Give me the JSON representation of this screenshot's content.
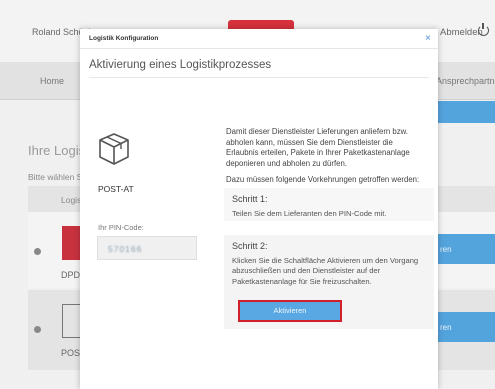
{
  "header": {
    "user_name": "Roland Schönh",
    "logout_label": "Abmelden",
    "icons": {
      "logout": "power-icon",
      "logo": "brand-logo"
    }
  },
  "nav": {
    "home": "Home",
    "contact": "Ansprechpartner"
  },
  "background": {
    "heading": "Ihre Logisti",
    "subtext": "Bitte wählen S",
    "column_header": "Logist",
    "rows": [
      {
        "label": "DPD-",
        "button": "ren"
      },
      {
        "label": "POST-",
        "button": "ren"
      }
    ]
  },
  "modal": {
    "window_title": "Logistik Konfiguration",
    "close_label": "×",
    "heading": "Aktivierung eines Logistikprozesses",
    "provider_name": "POST-AT",
    "pin_label": "Ihr PIN-Code:",
    "pin_value": "570166",
    "intro": "Damit dieser Dienstleister Lieferungen anliefern bzw. abholen kann, müssen Sie dem Dienstleister die Erlaubnis erteilen, Pakete in Ihrer Paketkastenanlage deponieren und abholen zu dürfen.",
    "steps_intro": "Dazu müssen folgende Vorkehrungen getroffen werden:",
    "step1_title": "Schritt 1:",
    "step1_text": "Teilen Sie dem Lieferanten den PIN-Code mit.",
    "step2_title": "Schritt 2:",
    "step2_text": "Klicken Sie die Schaltfläche Aktivieren um den Vorgang abzuschließen und den Dienstleister auf der Paketkastenanlage für Sie freizuschalten.",
    "activate_label": "Aktivieren"
  },
  "colors": {
    "accent_blue": "#53a3dd",
    "highlight_red": "#d2202a",
    "brand_red": "#d6313c"
  }
}
